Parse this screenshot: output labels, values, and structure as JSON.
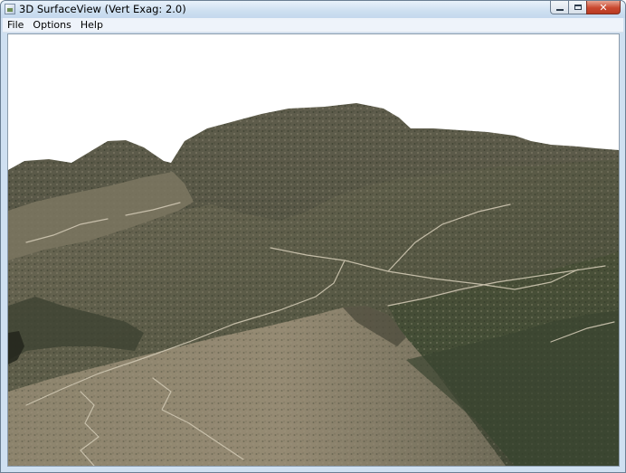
{
  "window": {
    "title": "3D SurfaceView (Vert Exag: 2.0)",
    "icon": "map-app-icon",
    "controls": {
      "minimize": "minimize-icon",
      "maximize": "maximize-icon",
      "close": "close-icon"
    }
  },
  "menubar": {
    "items": [
      {
        "label": "File"
      },
      {
        "label": "Options"
      },
      {
        "label": "Help"
      }
    ]
  },
  "viewport": {
    "content": "3d-terrain-surface",
    "sky_color": "#ffffff",
    "terrain_colors": {
      "dark_forest": "#3b4130",
      "mid_slope": "#5d5d4a",
      "light_ridge": "#8f8874",
      "bare_hill": "#9a8f78",
      "trail": "#c9c1ad"
    }
  }
}
